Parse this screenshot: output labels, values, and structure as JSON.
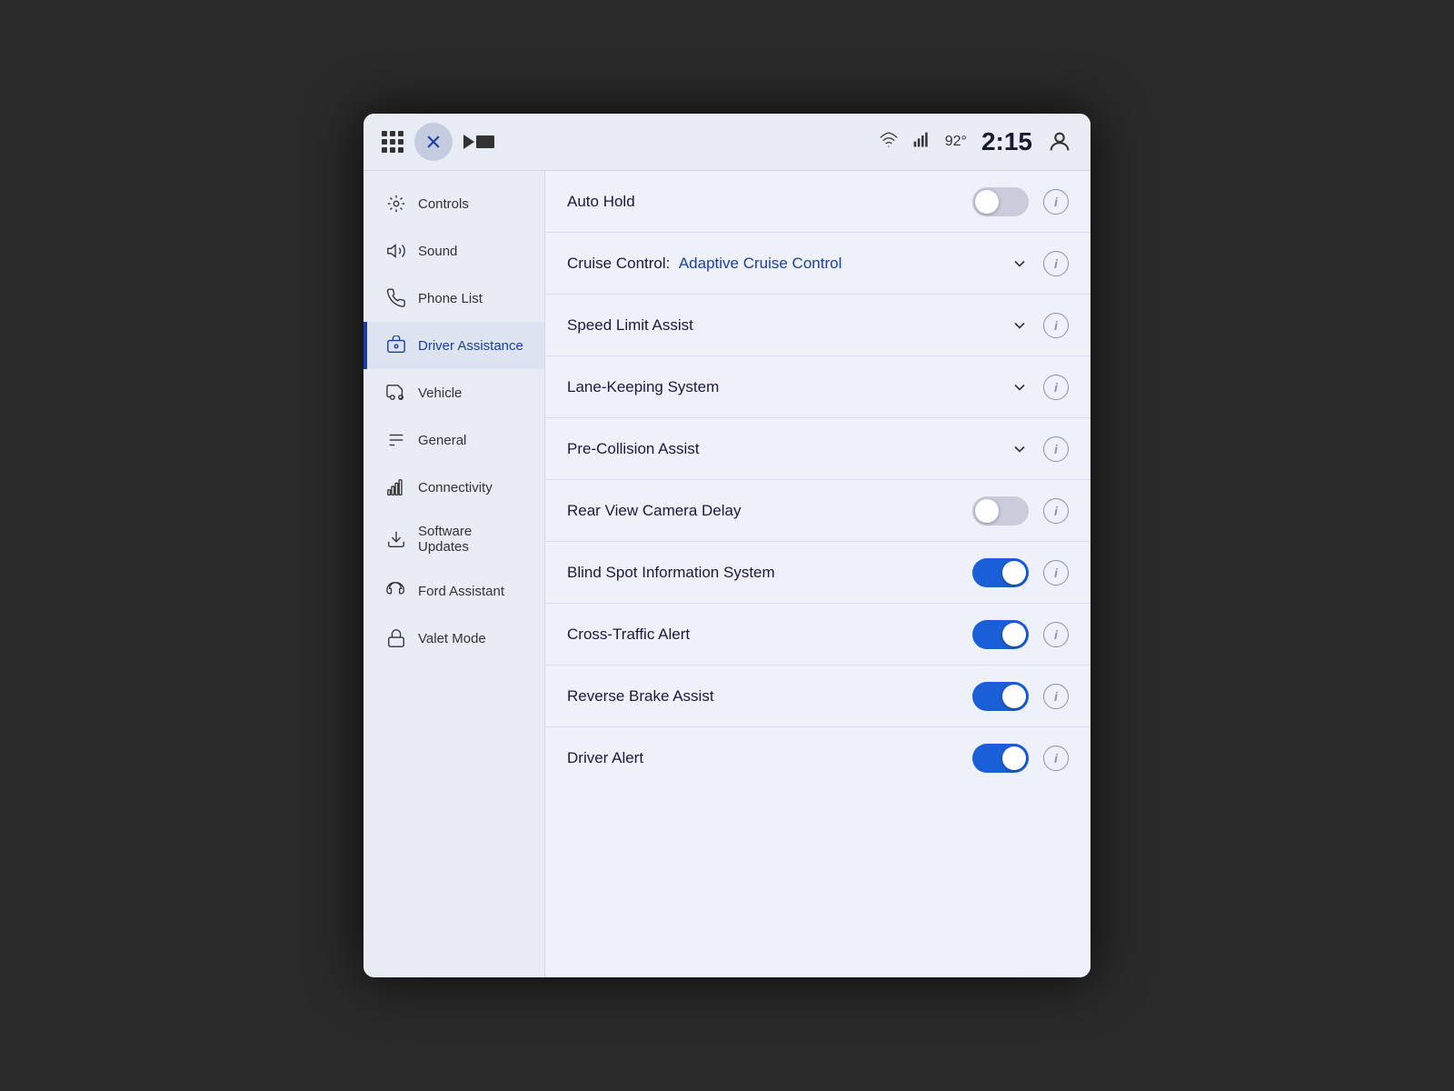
{
  "header": {
    "temp": "92°",
    "time": "2:15"
  },
  "sidebar": {
    "items": [
      {
        "id": "controls",
        "label": "Controls",
        "icon": "controls",
        "active": false
      },
      {
        "id": "sound",
        "label": "Sound",
        "icon": "sound",
        "active": false
      },
      {
        "id": "phone-list",
        "label": "Phone List",
        "icon": "phone",
        "active": false
      },
      {
        "id": "driver-assistance",
        "label": "Driver Assistance",
        "icon": "driver",
        "active": true
      },
      {
        "id": "vehicle",
        "label": "Vehicle",
        "icon": "vehicle",
        "active": false
      },
      {
        "id": "general",
        "label": "General",
        "icon": "general",
        "active": false
      },
      {
        "id": "connectivity",
        "label": "Connectivity",
        "icon": "connectivity",
        "active": false
      },
      {
        "id": "software-updates",
        "label": "Software Updates",
        "icon": "download",
        "active": false
      },
      {
        "id": "ford-assistant",
        "label": "Ford Assistant",
        "icon": "assistant",
        "active": false
      },
      {
        "id": "valet-mode",
        "label": "Valet Mode",
        "icon": "valet",
        "active": false
      }
    ]
  },
  "settings": {
    "rows": [
      {
        "id": "auto-hold",
        "label": "Auto Hold",
        "type": "toggle",
        "state": "off",
        "value": null
      },
      {
        "id": "cruise-control",
        "label": "Cruise Control:",
        "type": "dropdown",
        "value": "Adaptive Cruise Control"
      },
      {
        "id": "speed-limit",
        "label": "Speed Limit Assist",
        "type": "dropdown",
        "value": null
      },
      {
        "id": "lane-keeping",
        "label": "Lane-Keeping System",
        "type": "dropdown",
        "value": null
      },
      {
        "id": "pre-collision",
        "label": "Pre-Collision Assist",
        "type": "dropdown",
        "value": null
      },
      {
        "id": "rear-view-camera",
        "label": "Rear View Camera Delay",
        "type": "toggle",
        "state": "off",
        "value": null
      },
      {
        "id": "blind-spot",
        "label": "Blind Spot Information System",
        "type": "toggle",
        "state": "on",
        "value": null
      },
      {
        "id": "cross-traffic",
        "label": "Cross-Traffic Alert",
        "type": "toggle",
        "state": "on",
        "value": null
      },
      {
        "id": "reverse-brake",
        "label": "Reverse Brake Assist",
        "type": "toggle",
        "state": "on",
        "value": null
      },
      {
        "id": "driver-alert",
        "label": "Driver Alert",
        "type": "toggle",
        "state": "on",
        "value": null
      }
    ]
  }
}
